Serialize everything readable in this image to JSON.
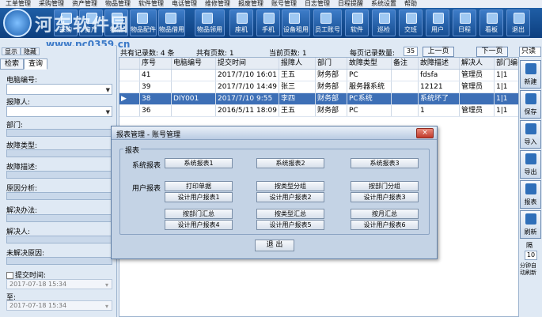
{
  "menubar": [
    "工单管理",
    "采购管理",
    "资产管理",
    "物品管理",
    "软件管理",
    "电话管理",
    "维修管理",
    "报废管理",
    "账号管理",
    "日志管理",
    "日程提醒",
    "系统设置",
    "帮助"
  ],
  "branding": {
    "logo_text": "河东软件园",
    "watermark": "www.pc0359.cn"
  },
  "toolbar": [
    "采购",
    "资产",
    "物品",
    "物品配件",
    "物品借用",
    "物品领用",
    "座机",
    "手机",
    "设备租用",
    "员工账号",
    "软件",
    "巡检",
    "交班",
    "用户",
    "日程",
    "看板",
    "退出"
  ],
  "left": {
    "top_tabs": [
      "显示",
      "隐藏"
    ],
    "tabs": [
      "检索",
      "查询"
    ],
    "fields": [
      "电脑编号:",
      "报障人:",
      "部门:",
      "故障类型:",
      "故障描述:",
      "原因分析:",
      "解决办法:",
      "解决人:",
      "未解决原因:"
    ],
    "submit_time_label": "提交时间:",
    "to_label": "至:",
    "date_from": "2017-07-18 15:34",
    "date_to": "2017-07-18 15:34"
  },
  "info": {
    "total_records": "共有记录数: 4 条",
    "total_pages": "共有页数: 1",
    "current_page": "当前页数: 1",
    "per_page_label": "每页记录数量:",
    "per_page_value": "35",
    "prev": "上一页",
    "next": "下一页",
    "mode": "只读"
  },
  "table": {
    "headers": [
      "序号",
      "电脑编号",
      "提交时间",
      "报障人",
      "部门",
      "故障类型",
      "备注",
      "故障描述",
      "解决人",
      "部门编号"
    ],
    "rows": [
      {
        "cells": [
          "41",
          "",
          "2017/7/10 16:01",
          "王五",
          "财务部",
          "PC",
          "",
          "fdsfa",
          "管理员",
          "1|1"
        ],
        "selected": false
      },
      {
        "cells": [
          "39",
          "",
          "2017/7/10 14:49",
          "张三",
          "财务部",
          "服务器系统",
          "",
          "12121",
          "管理员",
          "1|1"
        ],
        "selected": false
      },
      {
        "cells": [
          "38",
          "DIY001",
          "2017/7/10 9:55",
          "李四",
          "财务部",
          "PC系统",
          "",
          "系统坏了",
          "",
          "1|1"
        ],
        "selected": true
      },
      {
        "cells": [
          "36",
          "",
          "2016/5/11 18:09",
          "王五",
          "财务部",
          "PC",
          "",
          "1",
          "管理员",
          "1|1"
        ],
        "selected": false
      }
    ]
  },
  "rside": {
    "buttons": [
      "新建",
      "保存",
      "导入",
      "导出",
      "报表",
      "刷新"
    ],
    "label_a": "隔",
    "value": "10",
    "label_b": "分钟自动刷新"
  },
  "dialog": {
    "title": "报表管理 - 账号管理",
    "close": "×",
    "group": "报表",
    "system_label": "系统报表",
    "user_label": "用户报表",
    "system_buttons": [
      "系统报表1",
      "系统报表2",
      "系统报表3"
    ],
    "user_buttons": [
      "打印单据",
      "按类型分组",
      "按部门分组",
      "设计用户报表1",
      "设计用户报表2",
      "设计用户报表3",
      "按部门汇总",
      "按类型汇总",
      "按月汇总",
      "设计用户报表4",
      "设计用户报表5",
      "设计用户报表6"
    ],
    "exit": "退 出"
  }
}
